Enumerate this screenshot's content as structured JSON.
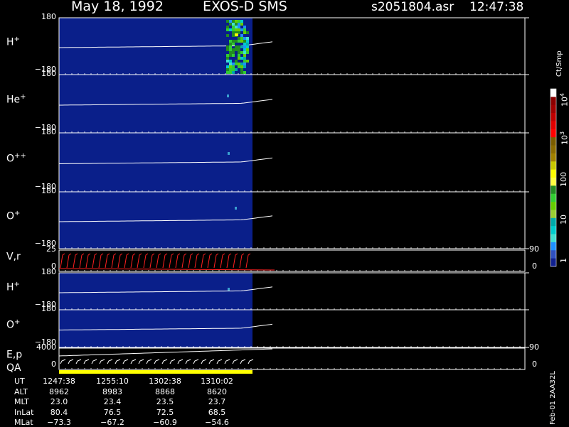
{
  "header": {
    "date": "May 18, 1992",
    "instrument": "EXOS-D SMS",
    "file": "s2051804.asr",
    "time": "12:47:38"
  },
  "panels": [
    {
      "label": "H",
      "sup": "+",
      "ymax": "180",
      "ymin": "−180"
    },
    {
      "label": "He",
      "sup": "+",
      "ymax": "180",
      "ymin": "−180"
    },
    {
      "label": "O",
      "sup": "++",
      "ymax": "180",
      "ymin": "−180"
    },
    {
      "label": "O",
      "sup": "+",
      "ymax": "180",
      "ymin": "−180"
    },
    {
      "label": "V,r",
      "sup": "",
      "ymax": "25",
      "ymin": "0",
      "rtop": "90",
      "rbot": "0"
    },
    {
      "label": "H",
      "sup": "+",
      "ymax": "180",
      "ymin": "−180"
    },
    {
      "label": "O",
      "sup": "+",
      "ymax": "180",
      "ymin": "−180"
    },
    {
      "label": "E,p",
      "sup": "",
      "ymax": "4000",
      "ymin": "0",
      "rtop": "90",
      "rbot": "0"
    }
  ],
  "qa_label": "QA",
  "colorbar": {
    "unit": "Ct/Smp",
    "labels": [
      "10",
      "4",
      "10",
      "3",
      "100",
      "10",
      "1"
    ],
    "colors": [
      "#ffffff",
      "#8b0000",
      "#a00000",
      "#c00000",
      "#e00000",
      "#ff0000",
      "#7a5c00",
      "#8b6b00",
      "#a08000",
      "#c8c800",
      "#ffff00",
      "#ffff40",
      "#228b22",
      "#32cd32",
      "#66cc00",
      "#9acd32",
      "#00aaaa",
      "#00cccc",
      "#40e0d0",
      "#1e90ff",
      "#3050c0",
      "#102090"
    ]
  },
  "ephemeris": {
    "rows": [
      "UT",
      "ALT",
      "MLT",
      "InLat",
      "MLat"
    ],
    "columns": [
      [
        "1247:38",
        "8962",
        "23.0",
        "80.4",
        "−73.3"
      ],
      [
        "1255:10",
        "8983",
        "23.4",
        "76.5",
        "−67.2"
      ],
      [
        "1302:38",
        "8868",
        "23.5",
        "72.5",
        "−60.9"
      ],
      [
        "1310:02",
        "8620",
        "23.7",
        "68.5",
        "−54.6"
      ]
    ]
  },
  "side_label": "Feb-01 2AA32L",
  "colors": {
    "background": "#000000",
    "data_fill": "#0a1f8a",
    "velocity": "#ff2020",
    "qa_bar": "#ffff00",
    "frame": "#ffffff"
  },
  "chart_data": {
    "type": "heatmap",
    "x_ticks": [
      "1247:38",
      "1255:10",
      "1302:38",
      "1310:02"
    ],
    "panels": [
      "H+",
      "He+",
      "O++",
      "O+",
      "V,r",
      "H+",
      "O+",
      "E,p"
    ],
    "y_range_pitch": [
      -180,
      180
    ],
    "y_range_velocity": [
      0,
      25
    ],
    "y_range_energy": [
      0,
      4000
    ],
    "right_axis_range": [
      0,
      90
    ],
    "colorbar_range_ct_smp": [
      1,
      10000
    ],
    "colorbar_scale": "log"
  }
}
